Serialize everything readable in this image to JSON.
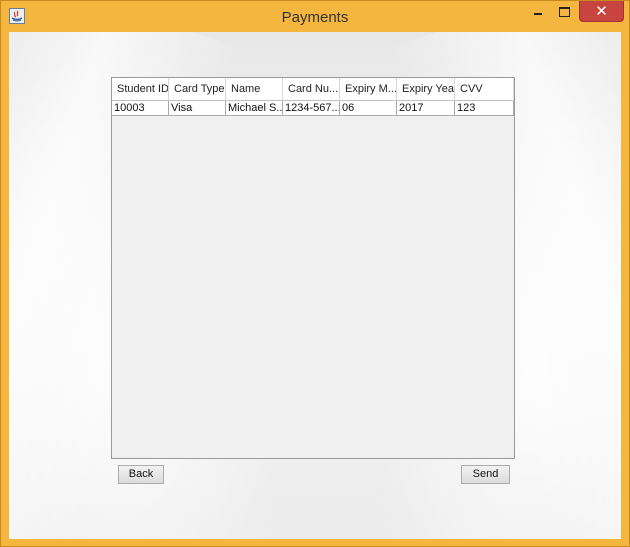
{
  "window": {
    "title": "Payments"
  },
  "table": {
    "columns": [
      "Student ID",
      "Card Type",
      "Name",
      "Card Nu...",
      "Expiry M...",
      "Expiry Year",
      "CVV"
    ],
    "rows": [
      [
        "10003",
        "Visa",
        "Michael S...",
        "1234-567...",
        "06",
        "2017",
        "123"
      ]
    ]
  },
  "buttons": {
    "back": "Back",
    "send": "Send"
  },
  "colors": {
    "frame": "#f4b63e",
    "close": "#c7443f"
  }
}
